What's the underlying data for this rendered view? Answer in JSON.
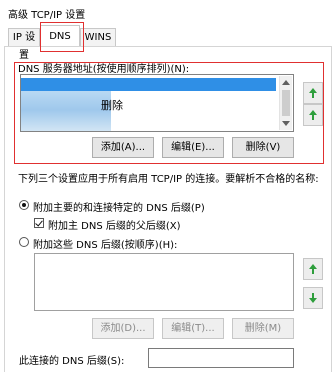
{
  "window": {
    "title": "高级 TCP/IP 设置"
  },
  "tabs": [
    {
      "label": "IP 设置",
      "active": false
    },
    {
      "label": "DNS",
      "active": true
    },
    {
      "label": "WINS",
      "active": false
    }
  ],
  "dns_servers": {
    "label": "DNS 服务器地址(按使用顺序排列)(N):",
    "overlay_text": "删除",
    "buttons": {
      "add": "添加(A)...",
      "edit": "编辑(E)...",
      "remove": "删除(V)"
    }
  },
  "resolution": {
    "description": "下列三个设置应用于所有启用 TCP/IP 的连接。要解析不合格的名称:",
    "option_primary": "附加主要的和连接特定的 DNS 后缀(P)",
    "option_parent": "附加主 DNS 后缀的父后缀(X)",
    "option_list": "附加这些 DNS 后缀(按顺序)(H):",
    "buttons": {
      "add": "添加(D)...",
      "edit": "编辑(T)...",
      "remove": "删除(M)"
    }
  },
  "connection_suffix": {
    "label": "此连接的 DNS 后缀(S):",
    "value": ""
  },
  "colors": {
    "highlight": "#2f8fe6",
    "annotation_red": "#e03030",
    "arrow_green": "#2e9e3c"
  },
  "icons": {
    "move_up": "green-up-arrow-icon",
    "move_down": "green-down-arrow-icon"
  }
}
